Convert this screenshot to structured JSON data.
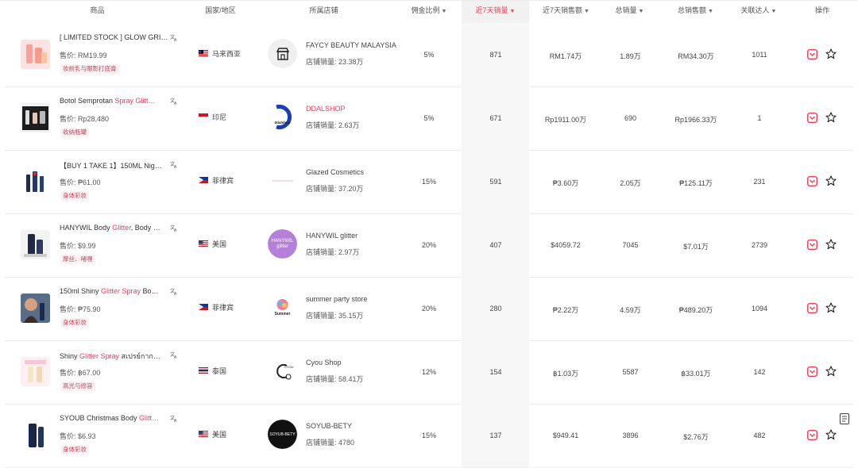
{
  "header": {
    "product": "商品",
    "country": "国家/地区",
    "shop": "所属店铺",
    "commission": "佣金比例",
    "sales7": "近7天销量",
    "revenue7": "近7天销售额",
    "total_sales": "总销量",
    "total_revenue": "总销售额",
    "creators": "关联达人",
    "actions": "操作"
  },
  "price_prefix": "售价: ",
  "shop_sales_prefix": "店铺销量: ",
  "colors": {
    "accent": "#f23c5a",
    "tag_bg": "#fdf0f2",
    "highlight_col": "#f7f7f7"
  },
  "rows": [
    {
      "title_pre": "[ LIMITED STOCK ] GLOW GRI…",
      "title_kw": "",
      "title_post": "",
      "price": "RM19.99",
      "tag": "妆前乳与眼影打底膏",
      "country": "马来西亚",
      "flag": "flag-malaysia",
      "shop_name": "FAYCY BEAUTY MALAYSIA",
      "shop_sales": "23.38万",
      "commission": "5%",
      "sales7": "871",
      "revenue7": "RM1.74万",
      "total_sales": "1.89万",
      "total_revenue": "RM34.30万",
      "creators": "1011"
    },
    {
      "title_pre": "Botol Semprotan ",
      "title_kw": "Spray Glitt…",
      "title_post": "",
      "price": "Rp28,480",
      "tag": "收纳瓶罐",
      "country": "印尼",
      "flag": "flag-indonesia",
      "shop_name": "DDALSHOP",
      "shop_sales": "2.63万",
      "commission": "5%",
      "sales7": "671",
      "revenue7": "Rp1911.00万",
      "total_sales": "690",
      "total_revenue": "Rp1966.33万",
      "creators": "1"
    },
    {
      "title_pre": "【BUY 1 TAKE 1】150ML Nig…",
      "title_kw": "",
      "title_post": "",
      "price": "₱61.00",
      "tag": "身体彩妆",
      "country": "菲律宾",
      "flag": "flag-philippines",
      "shop_name": "Glazed Cosmetics",
      "shop_sales": "37.20万",
      "commission": "15%",
      "sales7": "591",
      "revenue7": "₱3.60万",
      "total_sales": "2.05万",
      "total_revenue": "₱125.11万",
      "creators": "231"
    },
    {
      "title_pre": "HANYWIL Body ",
      "title_kw": "Glitter",
      "title_post": ", Body …",
      "price": "$9.99",
      "tag": "摩丝、啫喱",
      "country": "美国",
      "flag": "flag-usa",
      "shop_name": "HANYWIL glitter",
      "shop_sales": "2.97万",
      "commission": "20%",
      "sales7": "407",
      "revenue7": "$4059.72",
      "total_sales": "7045",
      "total_revenue": "$7.01万",
      "creators": "2739"
    },
    {
      "title_pre": "150ml Shiny ",
      "title_kw": "Glitter Spray",
      "title_post": " Bo…",
      "price": "₱75.90",
      "tag": "身体彩妆",
      "country": "菲律宾",
      "flag": "flag-philippines",
      "shop_name": "summer party store",
      "shop_sales": "35.15万",
      "commission": "20%",
      "sales7": "280",
      "revenue7": "₱2.22万",
      "total_sales": "4.59万",
      "total_revenue": "₱489.20万",
      "creators": "1094"
    },
    {
      "title_pre": "Shiny ",
      "title_kw": "Glitter Spray",
      "title_post": " สเปรย์กาก…",
      "price": "฿67.00",
      "tag": "高光与修容",
      "country": "泰国",
      "flag": "flag-thailand",
      "shop_name": "Cyou Shop",
      "shop_sales": "58.41万",
      "commission": "12%",
      "sales7": "154",
      "revenue7": "฿1.03万",
      "total_sales": "5587",
      "total_revenue": "฿33.01万",
      "creators": "142"
    },
    {
      "title_pre": "SYOUB Christmas Body ",
      "title_kw": "Glitt…",
      "title_post": "",
      "price": "$6.93",
      "tag": "身体彩妆",
      "country": "美国",
      "flag": "flag-usa",
      "shop_name": "SOYUB-BETY",
      "shop_sales": "4780",
      "commission": "15%",
      "sales7": "137",
      "revenue7": "$949.41",
      "total_sales": "3896",
      "total_revenue": "$2.76万",
      "creators": "482"
    }
  ],
  "logo_text": {
    "ddal": "ddalshop",
    "hanywil": "HANYWIL glitter",
    "summer": "Summer",
    "cyou": "CYOU",
    "soyub": "SOYUB-BETY"
  }
}
